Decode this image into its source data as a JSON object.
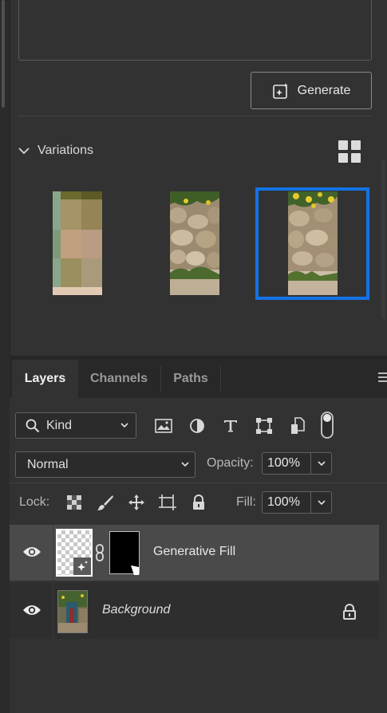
{
  "generate": {
    "button_label": "Generate",
    "icon": "generate-sparkle-icon"
  },
  "variations": {
    "header_label": "Variations",
    "collapse_icon": "chevron-down-icon",
    "view_icon": "grid-view-icon",
    "selected_index": 2
  },
  "colors": {
    "selection_border": "#1473e6",
    "panel_bg": "#323232"
  },
  "tabs": [
    {
      "label": "Layers",
      "active": true
    },
    {
      "label": "Channels",
      "active": false
    },
    {
      "label": "Paths",
      "active": false
    }
  ],
  "filter": {
    "kind_label": "Kind",
    "icons": [
      "pixel-layer-filter-icon",
      "adjustment-layer-filter-icon",
      "type-layer-filter-icon",
      "shape-layer-filter-icon",
      "smart-object-filter-icon"
    ]
  },
  "blend": {
    "mode": "Normal",
    "opacity_label": "Opacity:",
    "opacity_value": "100%"
  },
  "lock": {
    "label": "Lock:",
    "fill_label": "Fill:",
    "fill_value": "100%"
  },
  "layers": [
    {
      "name": "Generative Fill",
      "visible": true,
      "selected": true
    },
    {
      "name": "Background",
      "visible": true,
      "selected": false,
      "locked": true
    }
  ]
}
